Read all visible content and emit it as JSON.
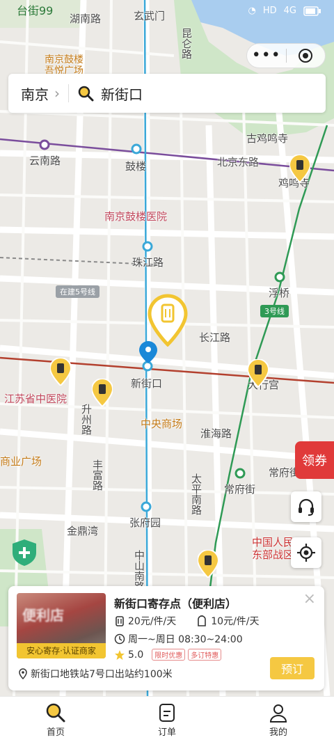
{
  "status_bar": {
    "time": "台街99",
    "indicators": [
      "HD",
      "4G"
    ]
  },
  "search": {
    "city": "南京",
    "chevron": "›",
    "query": "新街口"
  },
  "map": {
    "labels": {
      "xuanwumen": "玄武门",
      "hunan_rd": "湖南路",
      "jilin_rd": "昆仑路",
      "drum_tower_hotel": "南京鼓楼\n吾悦广场",
      "gujiming": "古鸡鸣寺",
      "yunnan_rd": "云南路",
      "gulou": "鼓楼",
      "beijing_e_rd": "北京东路",
      "jiming_si": "鸡鸣寺",
      "hospital": "南京鼓楼医院",
      "zhujiang_rd": "珠江路",
      "under_construction": "在建5号线",
      "fuqiao": "浮桥",
      "line3": "3号线",
      "changjiang_rd": "长江路",
      "xinjiekou": "新街口",
      "daxinggong": "大行宫",
      "tcm_hospital": "江苏省中医院",
      "central_mall": "中央商场",
      "huaihai_rd": "淮海路",
      "fengfu": "丰富路",
      "commerce_plaza": "商业广场",
      "changfu_st": "常府街",
      "changfu_st2": "常府街",
      "jindingwan": "金鼎湾",
      "zhangfuyuan": "张府园",
      "military": "中国人民\n东部战区",
      "jinzhou": "升州路",
      "zhongshan_s": "中山南路",
      "taiping": "太平南路"
    }
  },
  "coupon": {
    "label": "领券"
  },
  "card": {
    "photo_text": "便利店",
    "cert_label": "安心寄存·认证商家",
    "title": "新街口寄存点（便利店）",
    "price_small": "20元/件/天",
    "price_large": "10元/件/天",
    "hours": "周一~周日 08:30~24:00",
    "rating": "5.0",
    "tag1": "限时优惠",
    "tag2": "多订特惠",
    "address": "新街口地铁站7号口出站约100米",
    "book_label": "预订",
    "close": "×"
  },
  "nav": {
    "items": [
      {
        "label": "首页",
        "icon": "search-icon"
      },
      {
        "label": "订单",
        "icon": "order-icon"
      },
      {
        "label": "我的",
        "icon": "profile-icon"
      }
    ]
  },
  "colors": {
    "accent": "#f2c531",
    "metro_line1": "#3aa8d8",
    "metro_line2": "#c0392b",
    "metro_line3": "#2f9a55",
    "metro_line4": "#7a4d9c"
  }
}
